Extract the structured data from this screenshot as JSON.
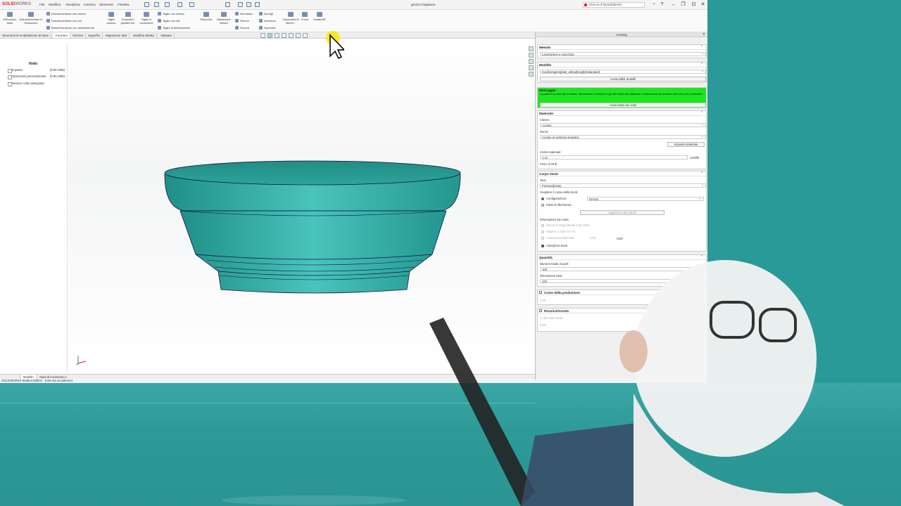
{
  "app": {
    "logo": "SOLID",
    "logo_suffix": "WORKS",
    "menus": [
      "File",
      "Modifica",
      "Visualizza",
      "Inserisci",
      "Strumenti",
      "Finestra"
    ],
    "document_title": "grezzo forgiatura",
    "search_placeholder": "Ricerca di MySolidWorks"
  },
  "ribbon": {
    "extrude_boss": "Estrusione base",
    "revolve_boss": "Estrusione/base in rivoluzione",
    "sweep_boss": "Estrusione/base con sweep",
    "loft_boss": "Estrusione/base con loft",
    "boundary_boss": "Base/Estrusione con delimitazione",
    "extruded_cut": "Taglio estruso",
    "hole_wizard": "Creazione guidata fori",
    "revolved_cut": "Taglio in rivoluzione",
    "swept_cut": "Taglio con sweep",
    "lofted_cut": "Taglio con loft",
    "boundary_cut": "Taglio di delimitazione",
    "fillet": "Raccordo",
    "linear_pattern": "Ripetizione lineare",
    "rib": "Nervatura",
    "draft": "Sformo",
    "shell": "Scocca",
    "wrap": "Avvolgi",
    "intersect": "Interseca",
    "mirror": "Specchia",
    "ref_geometry": "Geometria di riferim...",
    "curves": "Curve",
    "instant3d": "Instant3D"
  },
  "cm_tabs": [
    "Strumenti di modellazione di base",
    "Funzioni",
    "Schizzo",
    "Superfici",
    "Migrazione dati",
    "Modifica diretta",
    "Valutare"
  ],
  "tree": {
    "title": "finito",
    "items": [
      "Imposta",
      "Operazioni personalizzate",
      "Nessun costo assegnato"
    ],
    "values": [
      "(0.00 USD)",
      "(0.00 USD)"
    ]
  },
  "bottom_tabs": [
    "Modello",
    "Studi di movimento 1"
  ],
  "status": "SOLIDWORKS Student Edition - Solo uso accademico",
  "costing": {
    "title": "Costing",
    "method": {
      "header": "Metodo",
      "value": "Lavorazione a macchina"
    },
    "template": {
      "header": "Modello",
      "value": "machiningtemplate_default(englishstandard)",
      "button": "Avvia editor modelli"
    },
    "message": {
      "header": "Messaggio",
      "text": "La parte è pronta per la stima. Selezionare il metodo e gli altri criteri da utilizzare e selezionare Avvia stima dei costi per continuare.",
      "button": "Avvia stima dei costi",
      "color": "#1ee61e"
    },
    "material": {
      "header": "Materiale",
      "class_label": "Classe:",
      "class_value": "Acciaio",
      "name_label": "Nome:",
      "name_value": "Acciaio al carbonio semplice",
      "set_button": "Imposta materiale",
      "cost_label": "Costo materiale:",
      "cost_value": "1.41",
      "cost_unit": "USD/lb",
      "weight": "Peso: 0.00 lb"
    },
    "stock": {
      "header": "Corpo stock",
      "type_label": "Tipo:",
      "type_value": "Personalizzato",
      "choose_label": "Scegliere il corpo dello stock:",
      "config_label": "Configurazione:",
      "config_value": "Grezzo",
      "ref_label": "Parte di riferimento:",
      "update_button": "Aggiorna corpo stock",
      "info_label": "Informazioni sul costo:",
      "opt1": "Dati di Costing (attuali 0.00 USD)",
      "opt2": "Volume: 2.40E+3 m^3",
      "opt3": "Costo personalizzato:",
      "custom_value": "0.00",
      "custom_unit": "USD",
      "preview": "Anteprima stock"
    },
    "quantity": {
      "header": "Quantità",
      "total_label": "Numero totale di parti:",
      "total_value": "100",
      "lot_label": "Dimensione lotto:",
      "lot_value": "100"
    },
    "production": {
      "header": "Costo della produzione",
      "value": "0.00"
    },
    "markup": {
      "header": "Ricarico/Sconto",
      "label": "% del costo totale",
      "value": "0.0%"
    }
  },
  "colors": {
    "part": "#2aa59c",
    "highlight": "#1ee61e",
    "brand": "#d22222"
  }
}
